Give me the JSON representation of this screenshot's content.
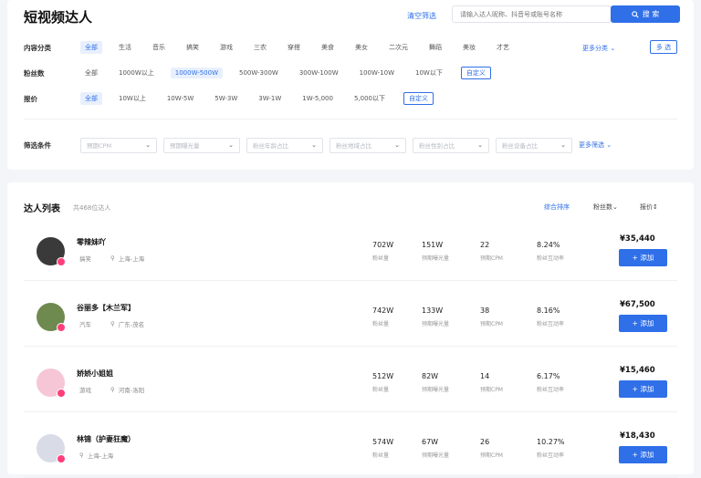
{
  "header": {
    "title": "短视频达人",
    "clear_filters": "清空筛选",
    "search_placeholder": "请输入达人昵称、抖音号或账号名称",
    "search_label": "搜 索",
    "search_icon": "search-icon"
  },
  "filters": {
    "category": {
      "label": "内容分类",
      "options": [
        "全部",
        "生活",
        "音乐",
        "搞笑",
        "游戏",
        "三农",
        "穿搭",
        "美食",
        "美女",
        "二次元",
        "舞蹈",
        "美妆",
        "才艺"
      ],
      "selected": "全部",
      "more": "更多分类",
      "multi": "多 选"
    },
    "fans": {
      "label": "粉丝数",
      "options": [
        "全部",
        "1000W以上",
        "1000W-500W",
        "500W-300W",
        "300W-100W",
        "100W-10W",
        "10W以下"
      ],
      "selected": "1000W-500W",
      "custom": "自定义"
    },
    "price": {
      "label": "报价",
      "options": [
        "全部",
        "10W以上",
        "10W-5W",
        "5W-3W",
        "3W-1W",
        "1W-5,000",
        "5,000以下"
      ],
      "selected": "全部",
      "custom": "自定义"
    },
    "conditions": {
      "label": "筛选条件",
      "selects": [
        "预期CPM",
        "预期曝光量",
        "粉丝年龄占比",
        "粉丝地域占比",
        "粉丝性别占比",
        "粉丝设备占比"
      ],
      "more": "更多筛选"
    }
  },
  "list": {
    "title": "达人列表",
    "count": "共468位达人",
    "sorts": [
      "综合排序",
      "粉丝数",
      "报价"
    ],
    "active_sort": "综合排序",
    "stat_labels": {
      "fans": "粉丝量",
      "exposure": "预期曝光量",
      "cpm": "预期CPM",
      "interaction": "粉丝互动率"
    },
    "add_label": "+ 添加",
    "influencers": [
      {
        "name": "零辣妹吖",
        "category": "搞笑",
        "location": "上海-上海",
        "fans": "702W",
        "exposure": "151W",
        "cpm": "22",
        "interaction": "8.24%",
        "price": "¥35,440",
        "avatar_color": "#3a3a3a"
      },
      {
        "name": "谷丽多【木兰军】",
        "category": "汽车",
        "location": "广东-茂名",
        "fans": "742W",
        "exposure": "133W",
        "cpm": "38",
        "interaction": "8.16%",
        "price": "¥67,500",
        "avatar_color": "#6f8a4e"
      },
      {
        "name": "娇娇小姐姐",
        "category": "游戏",
        "location": "河南-洛阳",
        "fans": "512W",
        "exposure": "82W",
        "cpm": "14",
        "interaction": "6.17%",
        "price": "¥15,460",
        "avatar_color": "#f6c6d6"
      },
      {
        "name": "林锦（护妻狂魔）",
        "category": "",
        "location": "上海-上海",
        "fans": "574W",
        "exposure": "67W",
        "cpm": "26",
        "interaction": "10.27%",
        "price": "¥18,430",
        "avatar_color": "#d9dbe6"
      }
    ]
  }
}
